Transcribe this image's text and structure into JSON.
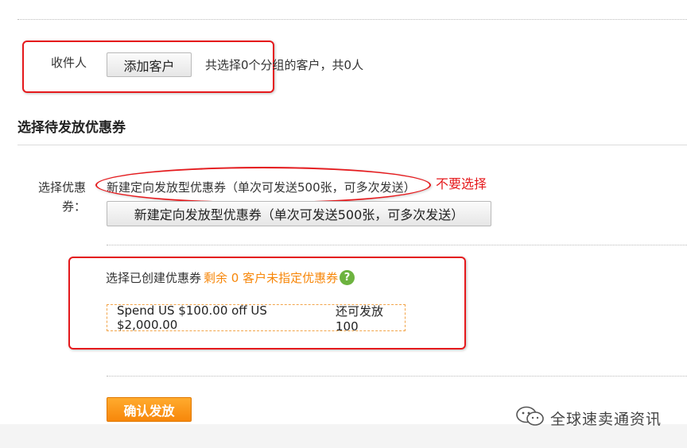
{
  "recipient": {
    "label": "收件人",
    "add_button": "添加客户",
    "summary": "共选择0个分组的客户，共0人"
  },
  "section_title": "选择待发放优惠券",
  "coupon_select": {
    "label_line1": "选择优惠",
    "label_line2": "券：",
    "option_text": "新建定向发放型优惠券（单次可发送500张，可多次发送）",
    "create_button": "新建定向发放型优惠券（单次可发送500张，可多次发送）",
    "annotation": "不要选择"
  },
  "existing_coupons": {
    "label": "选择已创建优惠券",
    "remaining": "剩余 0 客户未指定优惠券",
    "help_icon": "?",
    "coupon_text": "Spend US $100.00 off US $2,000.00",
    "coupon_remaining": "还可发放100"
  },
  "confirm_button": "确认发放",
  "watermark": "全球速卖通资讯",
  "colors": {
    "accent_orange": "#f7870a",
    "annotation_red": "#e5191c",
    "help_green": "#6db33f"
  }
}
